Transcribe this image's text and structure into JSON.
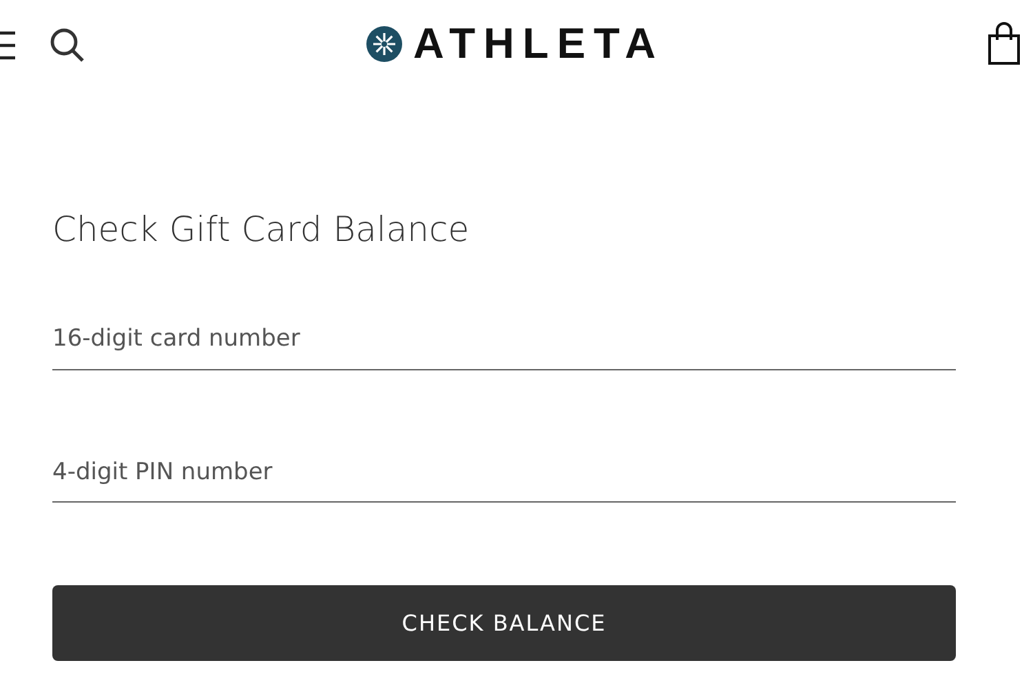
{
  "header": {
    "brand": "ATHLETA"
  },
  "form": {
    "title": "Check Gift Card Balance",
    "fields": [
      {
        "placeholder": "16-digit card number"
      },
      {
        "placeholder": "4-digit PIN number"
      }
    ],
    "button": "CHECK BALANCE"
  }
}
